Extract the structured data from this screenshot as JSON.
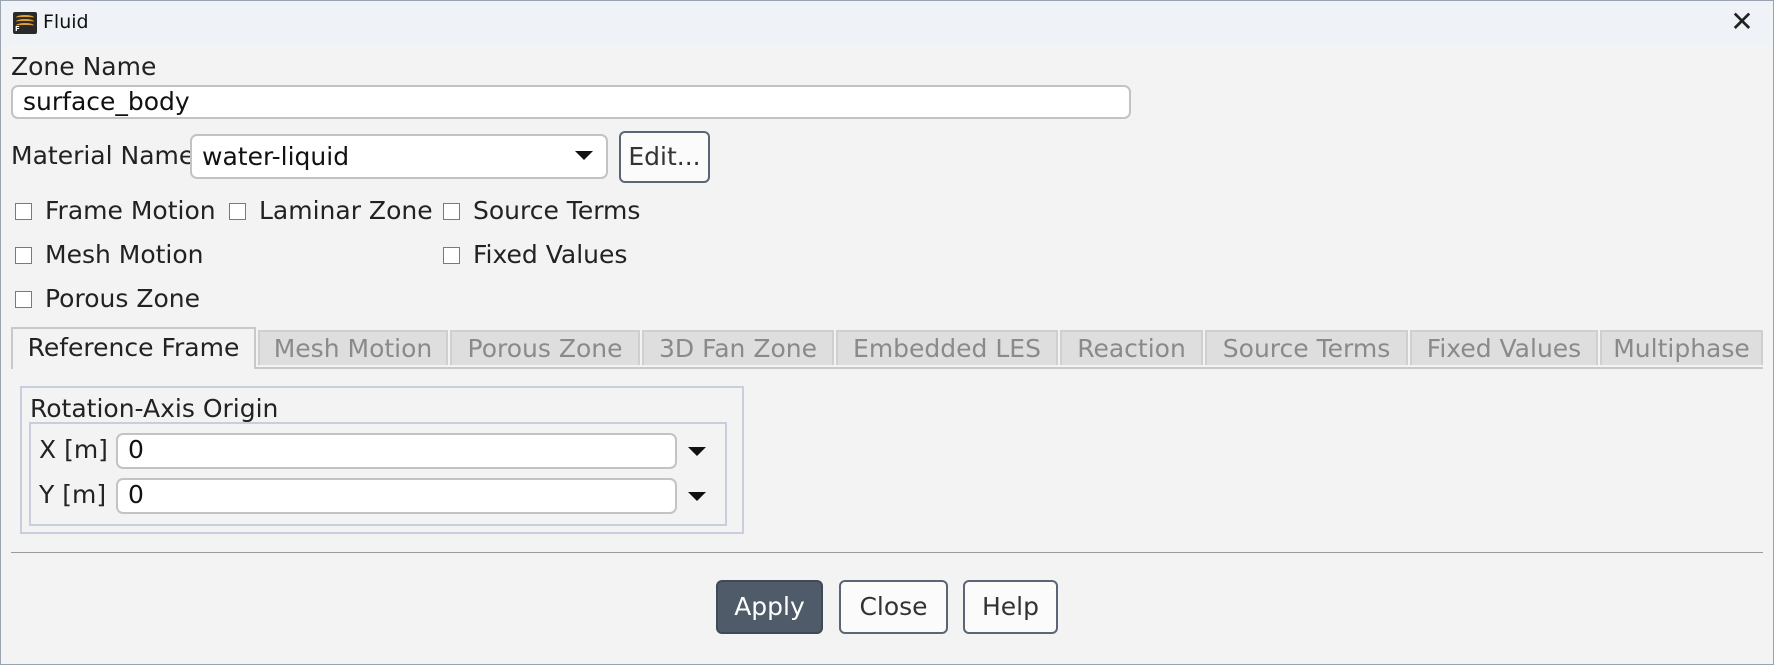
{
  "window": {
    "title": "Fluid",
    "icon": "fluent-app-icon",
    "icon_letter": "F",
    "close_glyph": "✕"
  },
  "zone_name": {
    "label": "Zone Name",
    "value": "surface_body"
  },
  "material": {
    "label": "Material Name",
    "value": "water-liquid",
    "edit_label": "Edit..."
  },
  "options": {
    "frame_motion": "Frame Motion",
    "laminar_zone": "Laminar Zone",
    "source_terms": "Source Terms",
    "mesh_motion": "Mesh Motion",
    "fixed_values": "Fixed Values",
    "porous_zone": "Porous Zone"
  },
  "tabs": [
    "Reference Frame",
    "Mesh Motion",
    "Porous Zone",
    "3D Fan Zone",
    "Embedded LES",
    "Reaction",
    "Source Terms",
    "Fixed Values",
    "Multiphase"
  ],
  "active_tab": "Reference Frame",
  "rotation_axis": {
    "title": "Rotation-Axis Origin",
    "x_label": "X [m]",
    "x_value": "0",
    "y_label": "Y [m]",
    "y_value": "0"
  },
  "buttons": {
    "apply": "Apply",
    "close": "Close",
    "help": "Help"
  },
  "colors": {
    "apply_bg": "#4f5b69",
    "apply_text": "#ffffff",
    "titlebar_bg": "#eff3f8",
    "panel_bg": "#f3f3f3"
  }
}
